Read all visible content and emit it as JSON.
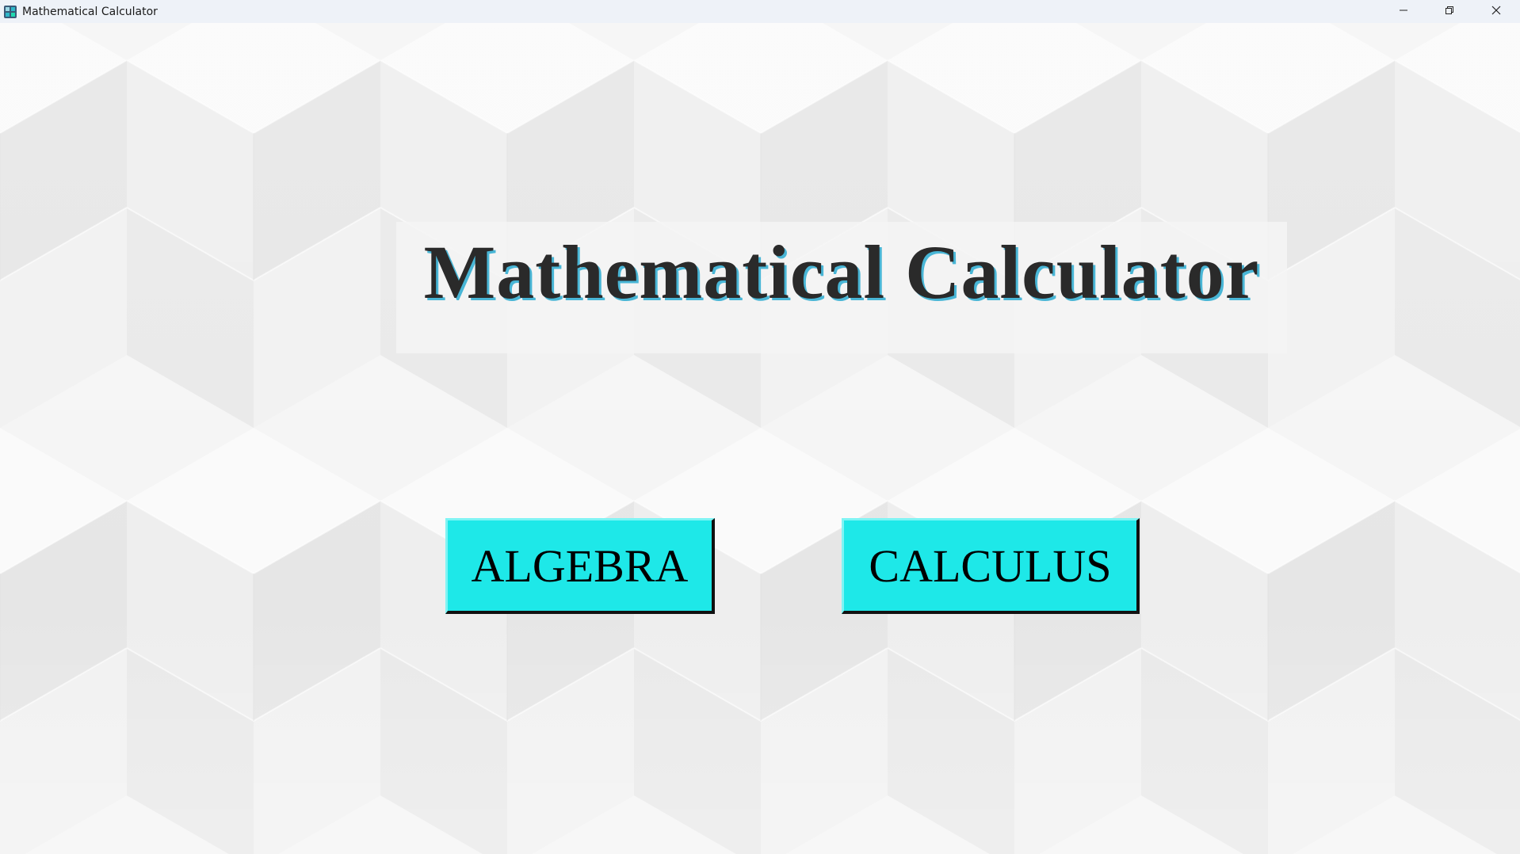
{
  "window": {
    "title": "Mathematical Calculator",
    "icon": "calculator-app-icon",
    "controls": [
      "minimize-icon",
      "restore-icon",
      "close-icon"
    ]
  },
  "main": {
    "heading": "Mathematical Calculator",
    "buttons": {
      "algebra": "ALGEBRA",
      "calculus": "CALCULUS"
    }
  },
  "colors": {
    "button_fill": "#1ee8e8",
    "title_text": "#2a2a2a",
    "title_shadow": "#49b6d6",
    "background": "#f4f4f4"
  }
}
